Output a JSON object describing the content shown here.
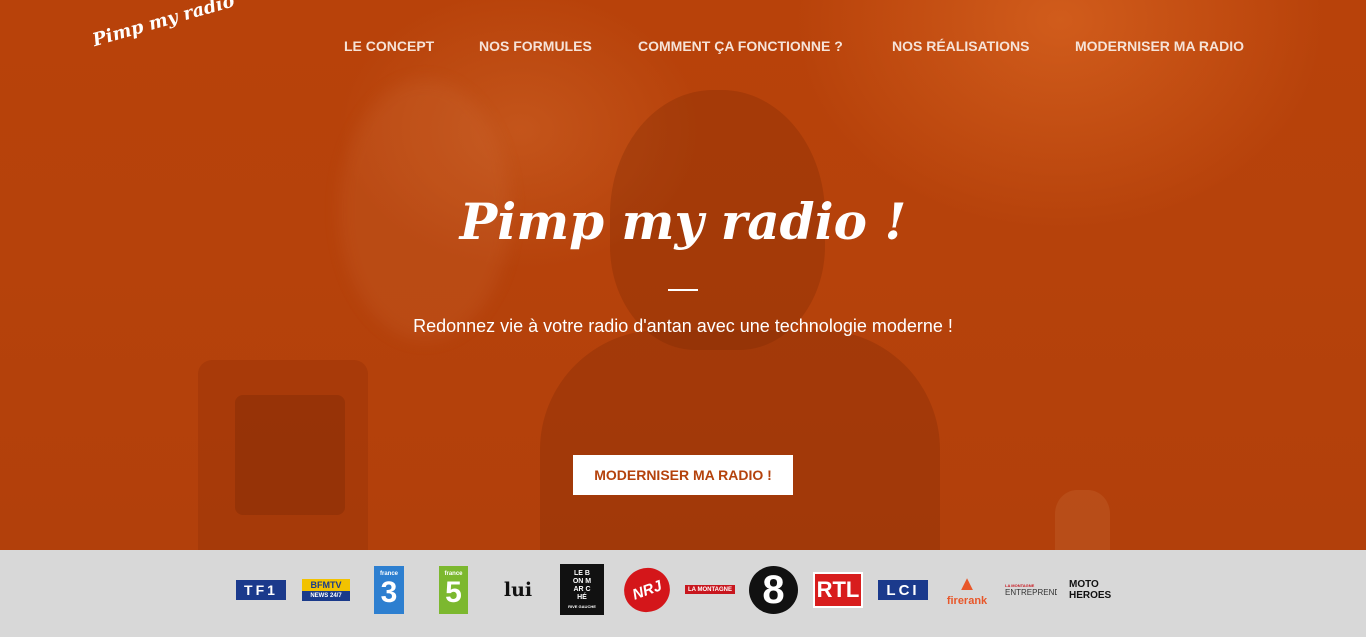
{
  "header": {
    "logo_text": "Pimp my radio",
    "nav": [
      {
        "label": "LE CONCEPT"
      },
      {
        "label": "NOS FORMULES"
      },
      {
        "label": "COMMENT ÇA FONCTIONNE ?"
      },
      {
        "label": "NOS RÉALISATIONS"
      },
      {
        "label": "MODERNISER MA RADIO"
      }
    ]
  },
  "hero": {
    "title": "Pimp my radio !",
    "tagline": "Redonnez vie à votre radio d'antan avec une technologie moderne !",
    "cta_label": "MODERNISER MA RADIO !"
  },
  "colors": {
    "hero_background": "#b8420a",
    "cta_text": "#b4420c",
    "logos_bar": "#d8d8d8"
  },
  "media_logos": [
    {
      "name": "TF1",
      "text": "TF1"
    },
    {
      "name": "BFM TV",
      "text": "BFMTV",
      "sub": "NEWS 24/7"
    },
    {
      "name": "France 3",
      "text": "3",
      "sub": "france"
    },
    {
      "name": "France 5",
      "text": "5",
      "sub": "france"
    },
    {
      "name": "Lui",
      "text": "lui"
    },
    {
      "name": "Le Bon Marché",
      "text": "LE BON MAR CHÉ",
      "sub": "RIVE GAUCHE"
    },
    {
      "name": "NRJ",
      "text": "NRJ"
    },
    {
      "name": "La Montagne",
      "text": "LA MONTAGNE"
    },
    {
      "name": "C8",
      "text": "8"
    },
    {
      "name": "RTL",
      "text": "RTL"
    },
    {
      "name": "LCI",
      "text": "LCI"
    },
    {
      "name": "Firerank",
      "text": "firerank"
    },
    {
      "name": "La Montagne Entreprendre",
      "text": "ENTREPRENDRE",
      "sub": "LA MONTAGNE"
    },
    {
      "name": "Moto Heroes",
      "text": "MOTO",
      "sub": "HEROES"
    }
  ]
}
